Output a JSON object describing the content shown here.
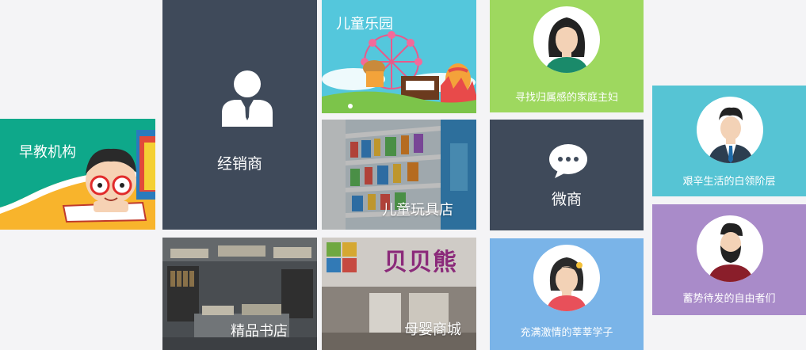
{
  "tiles": {
    "early_edu": {
      "label": "早教机构"
    },
    "dealer": {
      "label": "经销商"
    },
    "kids_park": {
      "label": "儿童乐园"
    },
    "toy_store": {
      "label": "儿童玩具店"
    },
    "boutique_bookstore": {
      "label": "精品书店"
    },
    "baby_mall": {
      "label": "母婴商城",
      "sign_text": "贝贝熊"
    },
    "housewife": {
      "label": "寻找归属感的家庭主妇"
    },
    "wechat_shop": {
      "label": "微商"
    },
    "students": {
      "label": "充满激情的莘莘学子"
    },
    "white_collar": {
      "label": "艰辛生活的白领阶层"
    },
    "freelancers": {
      "label": "蓄势待发的自由者们"
    }
  },
  "colors": {
    "background": "#f4f4f6",
    "dark_slate": "#3f4a5a",
    "green": "#9ed85f",
    "sky_blue": "#7ab4e8",
    "teal": "#56c4d4",
    "purple": "#a98bc9",
    "park_sky": "#54c7dc"
  }
}
